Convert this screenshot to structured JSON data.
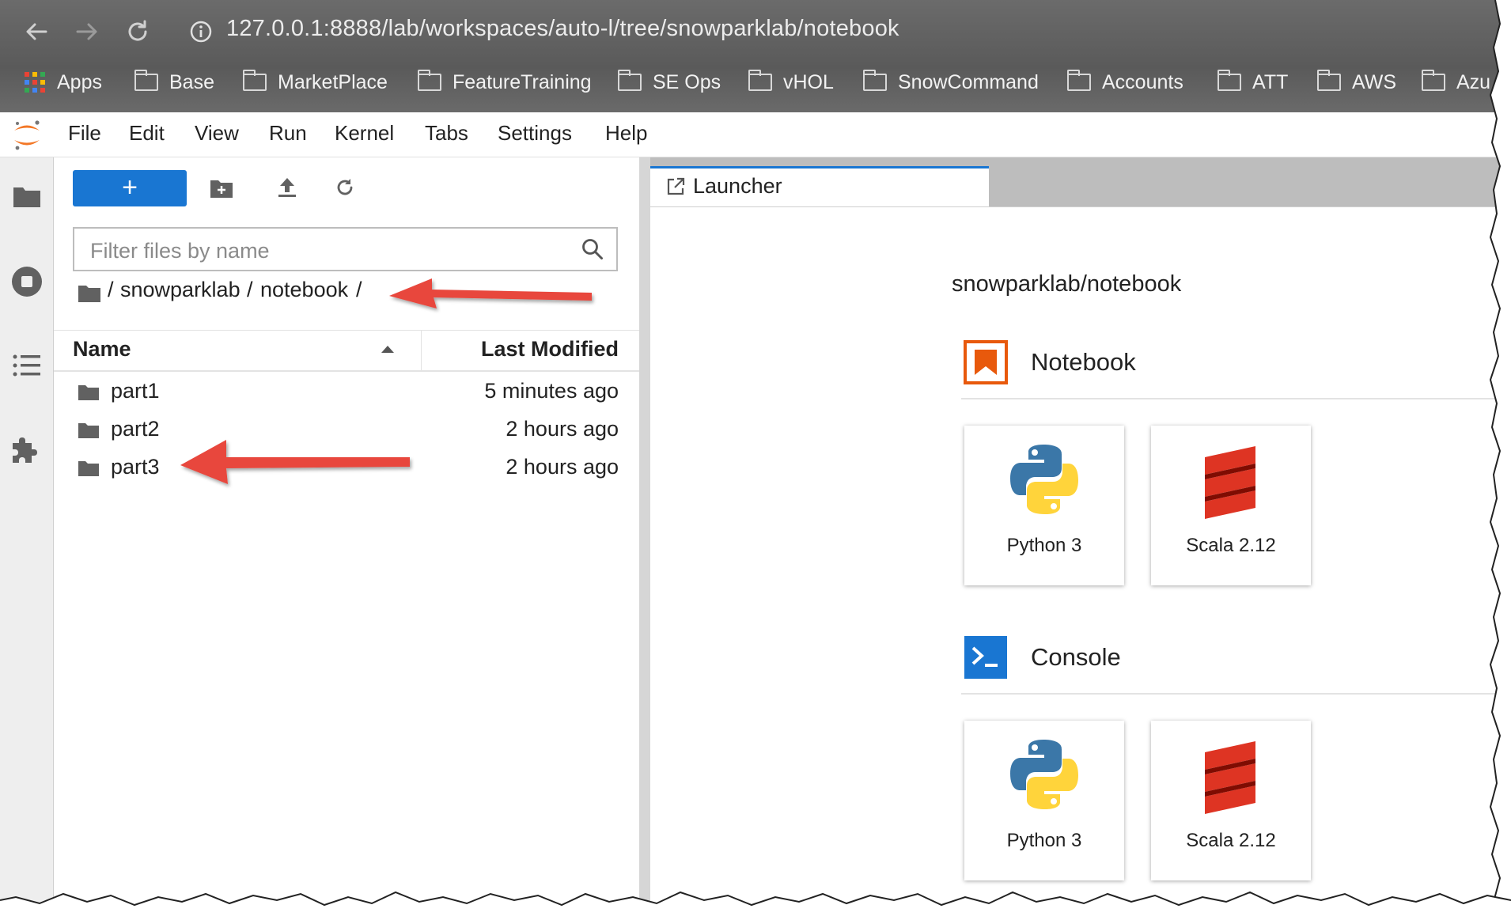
{
  "browser": {
    "url": "127.0.0.1:8888/lab/workspaces/auto-l/tree/snowparklab/notebook",
    "bookmarks": [
      "Apps",
      "Base",
      "MarketPlace",
      "FeatureTraining",
      "SE Ops",
      "vHOL",
      "SnowCommand",
      "Accounts",
      "ATT",
      "AWS",
      "Azu"
    ]
  },
  "menubar": {
    "items": [
      "File",
      "Edit",
      "View",
      "Run",
      "Kernel",
      "Tabs",
      "Settings",
      "Help"
    ]
  },
  "filebrowser": {
    "new_label": "+",
    "filter_placeholder": "Filter files by name",
    "breadcrumb": {
      "sep1": "/",
      "part1": "snowparklab",
      "sep2": "/",
      "part2": "notebook",
      "sep3": "/"
    },
    "columns": {
      "name": "Name",
      "last_modified": "Last Modified"
    },
    "rows": [
      {
        "name": "part1",
        "modified": "5 minutes ago"
      },
      {
        "name": "part2",
        "modified": "2 hours ago"
      },
      {
        "name": "part3",
        "modified": "2 hours ago"
      }
    ]
  },
  "tabs": [
    {
      "label": "Launcher"
    }
  ],
  "launcher": {
    "cwd": "snowparklab/notebook",
    "sections": [
      {
        "title": "Notebook",
        "cards": [
          "Python 3",
          "Scala 2.12"
        ]
      },
      {
        "title": "Console",
        "cards": [
          "Python 3",
          "Scala 2.12"
        ]
      }
    ]
  },
  "colors": {
    "accent": "#1976d2",
    "annotation_arrow": "#e8473d",
    "notebook_icon": "#e8590c",
    "console_icon": "#1976d2"
  }
}
